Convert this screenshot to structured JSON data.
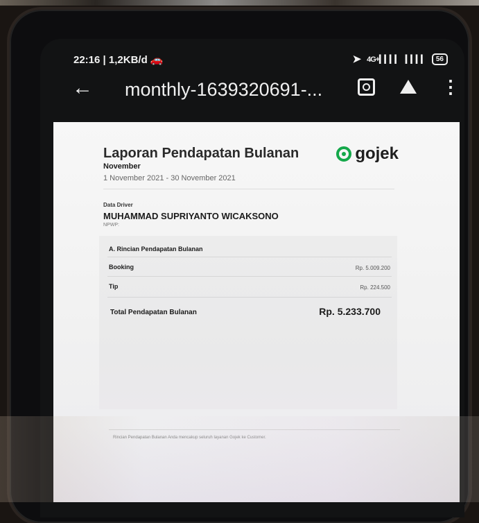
{
  "status_bar": {
    "time": "22:16 | 1,2KB/d",
    "network": "4G+",
    "battery": "56"
  },
  "app_bar": {
    "title": "monthly-1639320691-..."
  },
  "report": {
    "title": "Laporan Pendapatan Bulanan",
    "brand": "gojek",
    "month": "November",
    "period": "1 November 2021 - 30 November 2021",
    "driver_caption": "Data Driver",
    "driver_name": "MUHAMMAD SUPRIYANTO WICAKSONO",
    "npwp_label": "NPWP:",
    "section_title": "A. Rincian Pendapatan Bulanan",
    "rows": [
      {
        "label": "Booking",
        "value": "Rp. 5.009.200"
      },
      {
        "label": "Tip",
        "value": "Rp. 224.500"
      }
    ],
    "total_label": "Total Pendapatan Bulanan",
    "total_value": "Rp. 5.233.700",
    "footnote": "Rincian Pendapatan Bulanan Anda mencakup seluruh layanan Gojek ke Customer."
  },
  "colors": {
    "brand_green": "#14a84a"
  }
}
